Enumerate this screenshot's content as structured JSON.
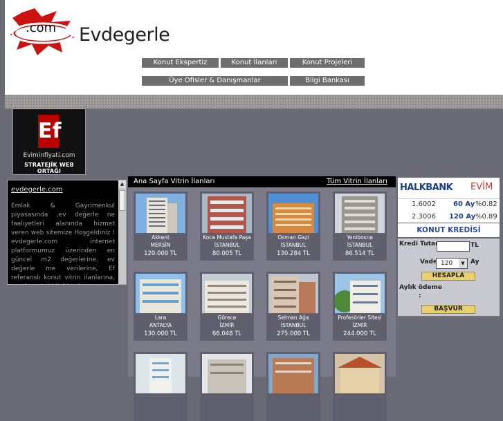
{
  "header": {
    "logo_com": ".com",
    "logo_text": "Evdegerle"
  },
  "nav": {
    "items": [
      "Konut Ekspertiz",
      "Konut İlanları",
      "Konut Projeleri",
      "Üye Ofisler & Danışmanlar",
      "Bilgi Bankası"
    ]
  },
  "partner": {
    "logo": "Ef",
    "site": "Eviminfiyati.com",
    "tagline": "STRATEJİK WEB ORTAĞI"
  },
  "left_box": {
    "title": "evdegerle.com",
    "body": "Emlak & Gayrimenkul piyasasında ,ev değerle ne faaliyetleri alanında hizmet veren web sitemize Hoşgeldiniz ! evdegerle.com internet platformumuz üzerinden en güncel m2 değerlerine, ev değerle me verilerine, Ef referanslı konut vitrin ilanlarına, gayrimenkul bilgi bankası"
  },
  "vitrin": {
    "title": "Ana Sayfa Vitrin İlanları",
    "all_link": "Tüm Vitrin İlanları",
    "listings": [
      {
        "name": "Akkent",
        "city": "MERSİN",
        "price": "120.000 TL"
      },
      {
        "name": "Koca Mustafa Paşa",
        "city": "İSTANBUL",
        "price": "80.005 TL"
      },
      {
        "name": "Osman Gazi",
        "city": "İSTANBUL",
        "price": "130.284 TL"
      },
      {
        "name": "Yenibosna",
        "city": "İSTANBUL",
        "price": "86.514 TL"
      },
      {
        "name": "Lara",
        "city": "ANTALYA",
        "price": "130.000 TL"
      },
      {
        "name": "Görece",
        "city": "İZMİR",
        "price": "66.048 TL"
      },
      {
        "name": "Selman Ağa",
        "city": "İSTANBUL",
        "price": "275.000 TL"
      },
      {
        "name": "Profesörler Sitesi",
        "city": "İZMİR",
        "price": "244.000 TL"
      }
    ]
  },
  "bank": {
    "name": "HALKBANK",
    "product": "EVİM",
    "rates": [
      {
        "amount": "1.6002",
        "term": "60 Ay",
        "rate": "%0.82"
      },
      {
        "amount": "2.3006",
        "term": "120 Ay",
        "rate": "%0.89"
      }
    ],
    "calc_title": "KONUT KREDİSİ HESAPLA",
    "credit_label": "Kredi Tutarı",
    "currency": "TL",
    "term_label": "Vade",
    "term_value": "120",
    "term_unit": "Ay",
    "calc_button": "HESAPLA",
    "monthly_label": "Aylık ödeme",
    "monthly_colon": ":",
    "apply_button": "BAŞVUR"
  },
  "colors": {
    "page_bg": "#6b6b78",
    "nav_bg": "#6e6e6e",
    "logo_red": "#cc1111",
    "bank_blue": "#1c3e86",
    "button_yellow": "#e8d070"
  }
}
